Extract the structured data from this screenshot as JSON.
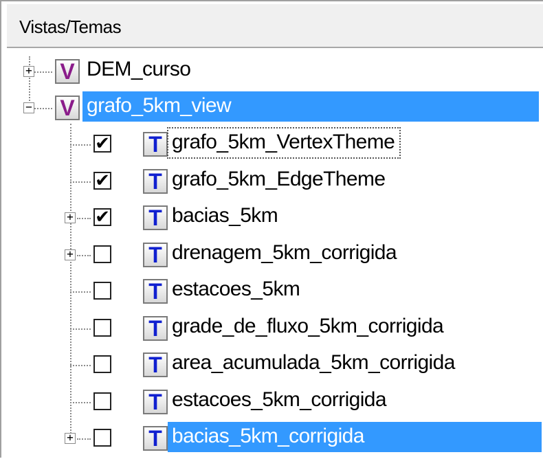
{
  "header": {
    "title": "Vistas/Temas"
  },
  "views": [
    {
      "label": "DEM_curso",
      "icon": "V",
      "expanded": false,
      "selected": false
    },
    {
      "label": "grafo_5km_view",
      "icon": "V",
      "expanded": true,
      "selected": true
    }
  ],
  "themes": [
    {
      "label": "grafo_5km_VertexTheme",
      "icon": "T",
      "checked": true,
      "expander": false,
      "selected": false,
      "focused": true
    },
    {
      "label": "grafo_5km_EdgeTheme",
      "icon": "T",
      "checked": true,
      "expander": false,
      "selected": false,
      "focused": false
    },
    {
      "label": "bacias_5km",
      "icon": "T",
      "checked": true,
      "expander": true,
      "selected": false,
      "focused": false
    },
    {
      "label": "drenagem_5km_corrigida",
      "icon": "T",
      "checked": false,
      "expander": true,
      "selected": false,
      "focused": false
    },
    {
      "label": "estacoes_5km",
      "icon": "T",
      "checked": false,
      "expander": false,
      "selected": false,
      "focused": false
    },
    {
      "label": "grade_de_fluxo_5km_corrigida",
      "icon": "T",
      "checked": false,
      "expander": false,
      "selected": false,
      "focused": false
    },
    {
      "label": "area_acumulada_5km_corrigida",
      "icon": "T",
      "checked": false,
      "expander": false,
      "selected": false,
      "focused": false
    },
    {
      "label": "estacoes_5km_corrigida",
      "icon": "T",
      "checked": false,
      "expander": false,
      "selected": false,
      "focused": false
    },
    {
      "label": "bacias_5km_corrigida",
      "icon": "T",
      "checked": false,
      "expander": true,
      "selected": true,
      "focused": false
    }
  ],
  "icons": {
    "view": "view-icon",
    "theme": "theme-icon",
    "check": "✔",
    "plus": "+",
    "minus": "−"
  },
  "colors": {
    "selection": "#3399ff",
    "view_letter": "#8a1c8a",
    "theme_letter": "#1020d0"
  }
}
